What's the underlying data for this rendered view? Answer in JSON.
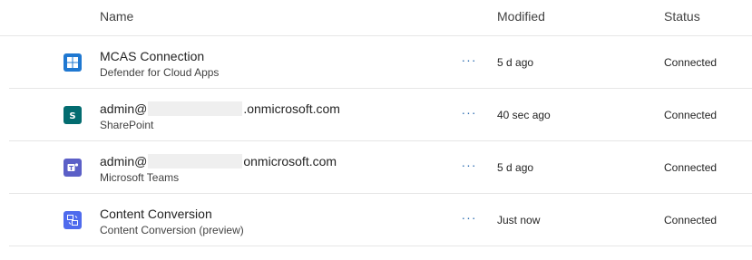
{
  "columns": {
    "name": "Name",
    "modified": "Modified",
    "status": "Status"
  },
  "rows": [
    {
      "icon": "defender-cloud-apps-icon",
      "icon_color": "#1f78d1",
      "title": "MCAS Connection",
      "title_prefix": "",
      "title_suffix": "",
      "subtitle": "Defender for Cloud Apps",
      "more": "···",
      "modified": "5 d ago",
      "status": "Connected"
    },
    {
      "icon": "sharepoint-icon",
      "icon_color": "#036c70",
      "title": "",
      "title_prefix": "admin@",
      "title_suffix": ".onmicrosoft.com",
      "subtitle": "SharePoint",
      "more": "···",
      "modified": "40 sec ago",
      "status": "Connected"
    },
    {
      "icon": "microsoft-teams-icon",
      "icon_color": "#5b5fc7",
      "title": "",
      "title_prefix": "admin@",
      "title_suffix": "onmicrosoft.com",
      "subtitle": "Microsoft Teams",
      "more": "···",
      "modified": "5 d ago",
      "status": "Connected"
    },
    {
      "icon": "content-conversion-icon",
      "icon_color": "#4f6bed",
      "title": "Content Conversion",
      "title_prefix": "",
      "title_suffix": "",
      "subtitle": "Content Conversion (preview)",
      "more": "···",
      "modified": "Just now",
      "status": "Connected"
    }
  ]
}
